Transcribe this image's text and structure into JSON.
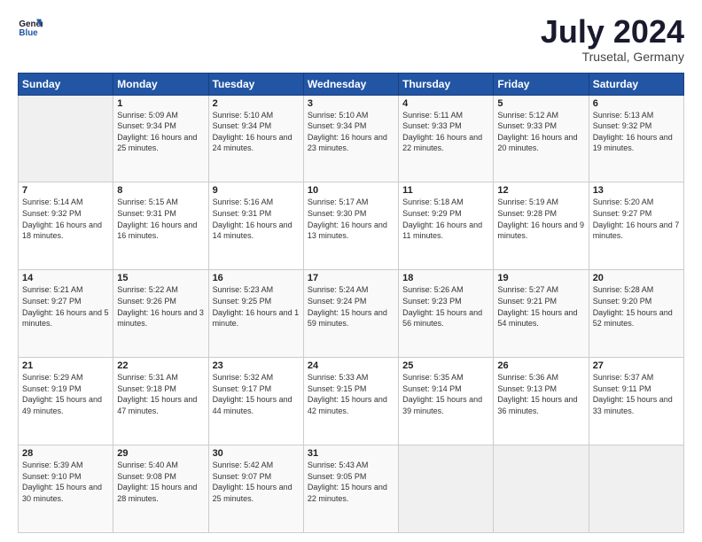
{
  "header": {
    "logo_general": "General",
    "logo_blue": "Blue",
    "month": "July 2024",
    "location": "Trusetal, Germany"
  },
  "weekdays": [
    "Sunday",
    "Monday",
    "Tuesday",
    "Wednesday",
    "Thursday",
    "Friday",
    "Saturday"
  ],
  "weeks": [
    [
      {
        "day": "",
        "sunrise": "",
        "sunset": "",
        "daylight": ""
      },
      {
        "day": "1",
        "sunrise": "Sunrise: 5:09 AM",
        "sunset": "Sunset: 9:34 PM",
        "daylight": "Daylight: 16 hours and 25 minutes."
      },
      {
        "day": "2",
        "sunrise": "Sunrise: 5:10 AM",
        "sunset": "Sunset: 9:34 PM",
        "daylight": "Daylight: 16 hours and 24 minutes."
      },
      {
        "day": "3",
        "sunrise": "Sunrise: 5:10 AM",
        "sunset": "Sunset: 9:34 PM",
        "daylight": "Daylight: 16 hours and 23 minutes."
      },
      {
        "day": "4",
        "sunrise": "Sunrise: 5:11 AM",
        "sunset": "Sunset: 9:33 PM",
        "daylight": "Daylight: 16 hours and 22 minutes."
      },
      {
        "day": "5",
        "sunrise": "Sunrise: 5:12 AM",
        "sunset": "Sunset: 9:33 PM",
        "daylight": "Daylight: 16 hours and 20 minutes."
      },
      {
        "day": "6",
        "sunrise": "Sunrise: 5:13 AM",
        "sunset": "Sunset: 9:32 PM",
        "daylight": "Daylight: 16 hours and 19 minutes."
      }
    ],
    [
      {
        "day": "7",
        "sunrise": "Sunrise: 5:14 AM",
        "sunset": "Sunset: 9:32 PM",
        "daylight": "Daylight: 16 hours and 18 minutes."
      },
      {
        "day": "8",
        "sunrise": "Sunrise: 5:15 AM",
        "sunset": "Sunset: 9:31 PM",
        "daylight": "Daylight: 16 hours and 16 minutes."
      },
      {
        "day": "9",
        "sunrise": "Sunrise: 5:16 AM",
        "sunset": "Sunset: 9:31 PM",
        "daylight": "Daylight: 16 hours and 14 minutes."
      },
      {
        "day": "10",
        "sunrise": "Sunrise: 5:17 AM",
        "sunset": "Sunset: 9:30 PM",
        "daylight": "Daylight: 16 hours and 13 minutes."
      },
      {
        "day": "11",
        "sunrise": "Sunrise: 5:18 AM",
        "sunset": "Sunset: 9:29 PM",
        "daylight": "Daylight: 16 hours and 11 minutes."
      },
      {
        "day": "12",
        "sunrise": "Sunrise: 5:19 AM",
        "sunset": "Sunset: 9:28 PM",
        "daylight": "Daylight: 16 hours and 9 minutes."
      },
      {
        "day": "13",
        "sunrise": "Sunrise: 5:20 AM",
        "sunset": "Sunset: 9:27 PM",
        "daylight": "Daylight: 16 hours and 7 minutes."
      }
    ],
    [
      {
        "day": "14",
        "sunrise": "Sunrise: 5:21 AM",
        "sunset": "Sunset: 9:27 PM",
        "daylight": "Daylight: 16 hours and 5 minutes."
      },
      {
        "day": "15",
        "sunrise": "Sunrise: 5:22 AM",
        "sunset": "Sunset: 9:26 PM",
        "daylight": "Daylight: 16 hours and 3 minutes."
      },
      {
        "day": "16",
        "sunrise": "Sunrise: 5:23 AM",
        "sunset": "Sunset: 9:25 PM",
        "daylight": "Daylight: 16 hours and 1 minute."
      },
      {
        "day": "17",
        "sunrise": "Sunrise: 5:24 AM",
        "sunset": "Sunset: 9:24 PM",
        "daylight": "Daylight: 15 hours and 59 minutes."
      },
      {
        "day": "18",
        "sunrise": "Sunrise: 5:26 AM",
        "sunset": "Sunset: 9:23 PM",
        "daylight": "Daylight: 15 hours and 56 minutes."
      },
      {
        "day": "19",
        "sunrise": "Sunrise: 5:27 AM",
        "sunset": "Sunset: 9:21 PM",
        "daylight": "Daylight: 15 hours and 54 minutes."
      },
      {
        "day": "20",
        "sunrise": "Sunrise: 5:28 AM",
        "sunset": "Sunset: 9:20 PM",
        "daylight": "Daylight: 15 hours and 52 minutes."
      }
    ],
    [
      {
        "day": "21",
        "sunrise": "Sunrise: 5:29 AM",
        "sunset": "Sunset: 9:19 PM",
        "daylight": "Daylight: 15 hours and 49 minutes."
      },
      {
        "day": "22",
        "sunrise": "Sunrise: 5:31 AM",
        "sunset": "Sunset: 9:18 PM",
        "daylight": "Daylight: 15 hours and 47 minutes."
      },
      {
        "day": "23",
        "sunrise": "Sunrise: 5:32 AM",
        "sunset": "Sunset: 9:17 PM",
        "daylight": "Daylight: 15 hours and 44 minutes."
      },
      {
        "day": "24",
        "sunrise": "Sunrise: 5:33 AM",
        "sunset": "Sunset: 9:15 PM",
        "daylight": "Daylight: 15 hours and 42 minutes."
      },
      {
        "day": "25",
        "sunrise": "Sunrise: 5:35 AM",
        "sunset": "Sunset: 9:14 PM",
        "daylight": "Daylight: 15 hours and 39 minutes."
      },
      {
        "day": "26",
        "sunrise": "Sunrise: 5:36 AM",
        "sunset": "Sunset: 9:13 PM",
        "daylight": "Daylight: 15 hours and 36 minutes."
      },
      {
        "day": "27",
        "sunrise": "Sunrise: 5:37 AM",
        "sunset": "Sunset: 9:11 PM",
        "daylight": "Daylight: 15 hours and 33 minutes."
      }
    ],
    [
      {
        "day": "28",
        "sunrise": "Sunrise: 5:39 AM",
        "sunset": "Sunset: 9:10 PM",
        "daylight": "Daylight: 15 hours and 30 minutes."
      },
      {
        "day": "29",
        "sunrise": "Sunrise: 5:40 AM",
        "sunset": "Sunset: 9:08 PM",
        "daylight": "Daylight: 15 hours and 28 minutes."
      },
      {
        "day": "30",
        "sunrise": "Sunrise: 5:42 AM",
        "sunset": "Sunset: 9:07 PM",
        "daylight": "Daylight: 15 hours and 25 minutes."
      },
      {
        "day": "31",
        "sunrise": "Sunrise: 5:43 AM",
        "sunset": "Sunset: 9:05 PM",
        "daylight": "Daylight: 15 hours and 22 minutes."
      },
      {
        "day": "",
        "sunrise": "",
        "sunset": "",
        "daylight": ""
      },
      {
        "day": "",
        "sunrise": "",
        "sunset": "",
        "daylight": ""
      },
      {
        "day": "",
        "sunrise": "",
        "sunset": "",
        "daylight": ""
      }
    ]
  ]
}
